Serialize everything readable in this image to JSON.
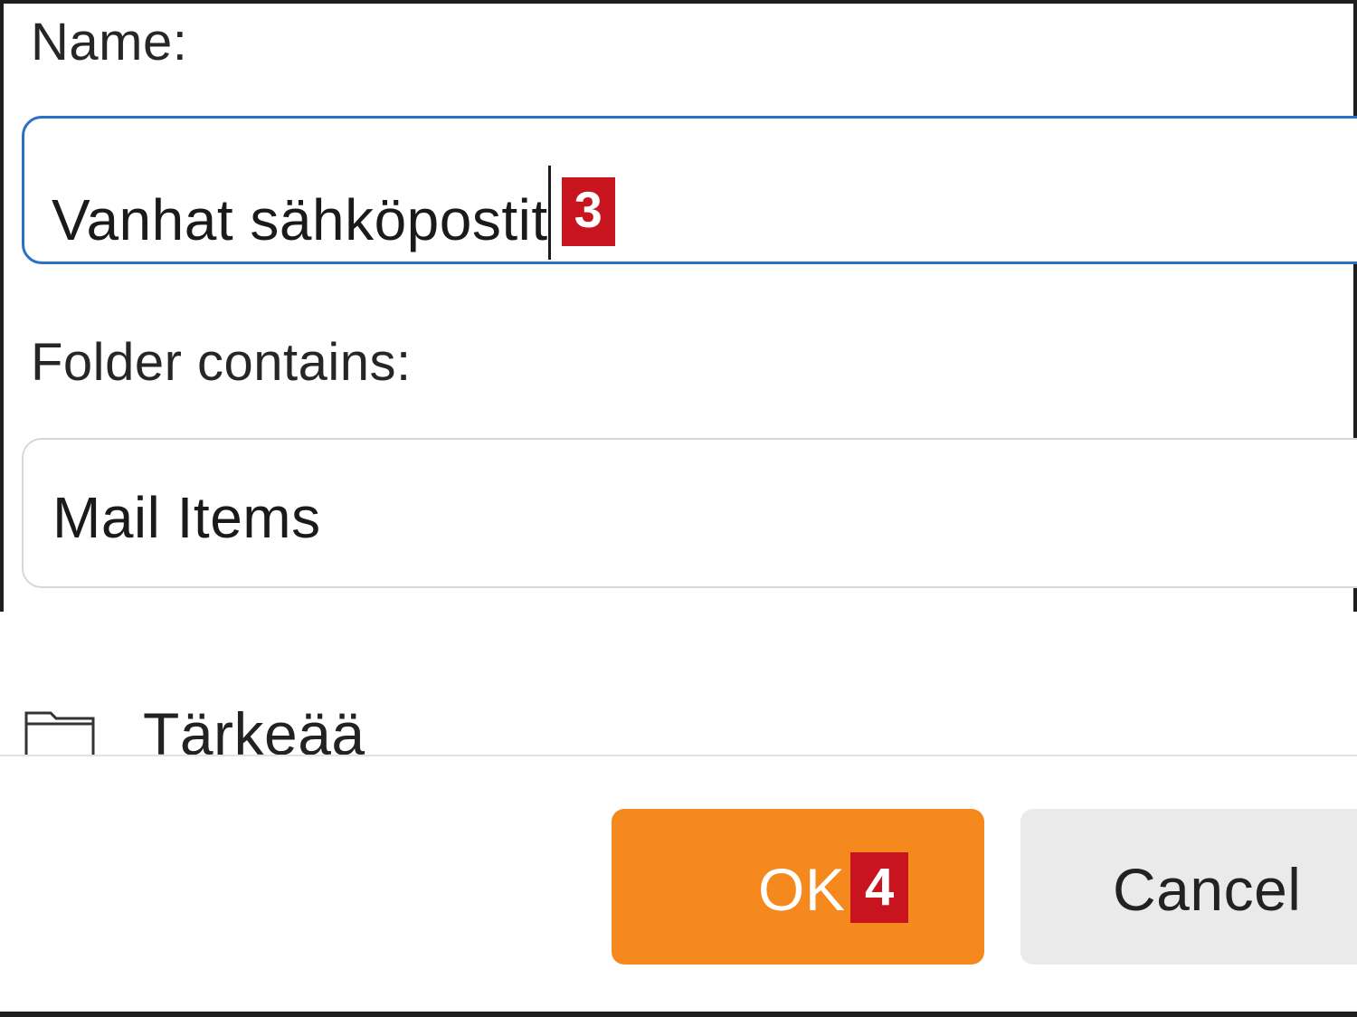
{
  "dialog": {
    "name_label": "Name:",
    "name_value": "Vanhat sähköpostit",
    "name_badge": "3",
    "contains_label": "Folder contains:",
    "contains_value": "Mail Items"
  },
  "folder_tree": {
    "items": [
      {
        "label": "Tärkeää",
        "icon": "folder-icon"
      }
    ]
  },
  "buttons": {
    "ok_label": "OK",
    "ok_badge": "4",
    "cancel_label": "Cancel"
  },
  "colors": {
    "accent_orange": "#f5891e",
    "focus_blue": "#2b6fc9",
    "badge_red": "#c8141f"
  }
}
